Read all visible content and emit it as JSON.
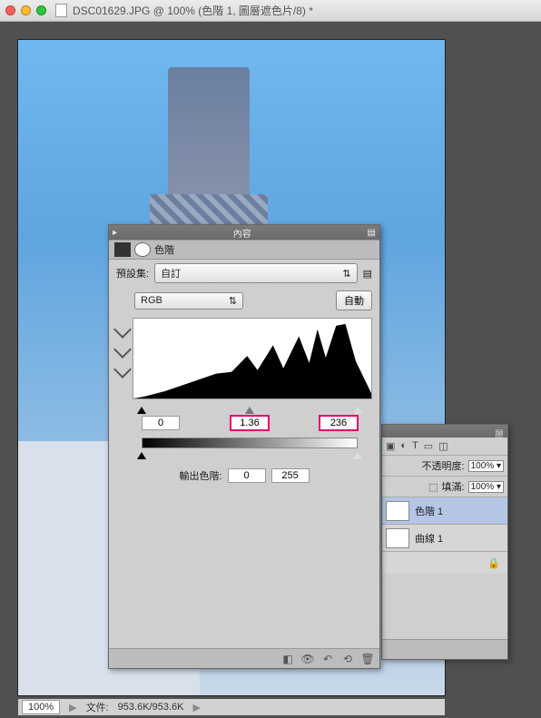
{
  "window": {
    "title": "DSC01629.JPG @ 100% (色階 1, 圖層遮色片/8) *"
  },
  "statusbar": {
    "zoom": "100%",
    "fileinfo_label": "文件:",
    "fileinfo_value": "953.6K/953.6K"
  },
  "levels": {
    "panel_title": "內容",
    "tab_label": "色階",
    "preset_label": "預設集:",
    "preset_value": "自訂",
    "channel_value": "RGB",
    "auto_btn": "自動",
    "shadow": "0",
    "gamma": "1.36",
    "highlight": "236",
    "output_label": "輸出色階:",
    "out_lo": "0",
    "out_hi": "255"
  },
  "layers": {
    "tab_hint": "層",
    "opacity_label": "不透明度:",
    "opacity_value": "100%",
    "fill_label": "填滿:",
    "fill_value": "100%",
    "layer1": "色階 1",
    "layer2": "曲線 1"
  }
}
